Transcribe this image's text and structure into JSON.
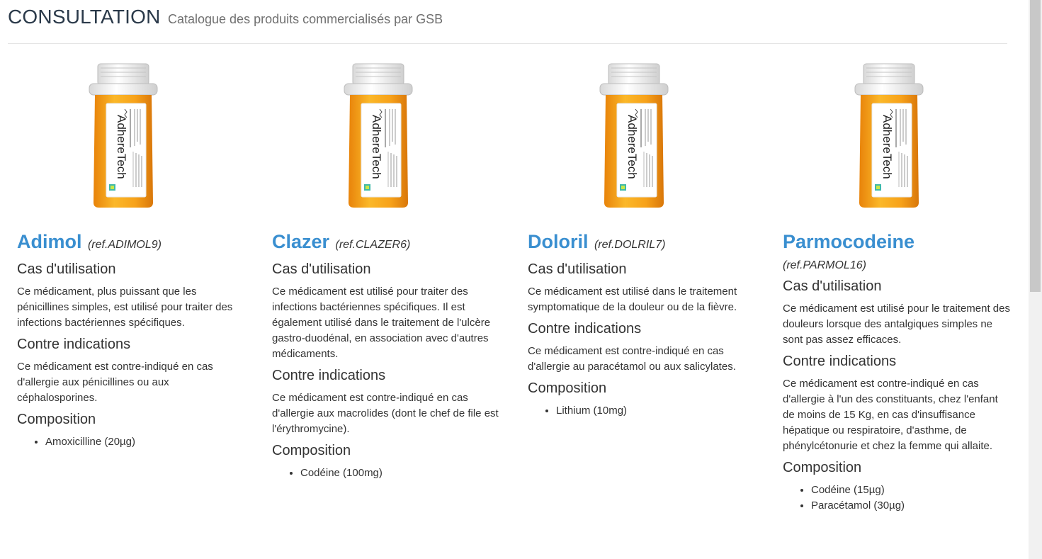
{
  "header": {
    "title": "CONSULTATION",
    "subtitle": "Catalogue des produits commercialisés par GSB"
  },
  "colors": {
    "accent": "#3a8fd0",
    "cap": "#eeeeee",
    "bottle": "#f5a316",
    "label": "#ffffff"
  },
  "bottle": {
    "brand": "AdhereTech"
  },
  "products": [
    {
      "name": "Adimol",
      "ref": "(ref.ADIMOL9)",
      "usage_heading": "Cas d'utilisation",
      "usage_text": "Ce médicament, plus puissant que les pénicillines simples, est utilisé pour traiter des infections bactériennes spécifiques.",
      "contra_heading": "Contre indications",
      "contra_text": "Ce médicament est contre-indiqué en cas d'allergie aux pénicillines ou aux céphalosporines.",
      "composition_heading": "Composition",
      "composition": [
        "Amoxicilline (20µg)"
      ]
    },
    {
      "name": "Clazer",
      "ref": "(ref.CLAZER6)",
      "usage_heading": "Cas d'utilisation",
      "usage_text": "Ce médicament est utilisé pour traiter des infections bactériennes spécifiques. Il est également utilisé dans le traitement de l'ulcère gastro-duodénal, en association avec d'autres médicaments.",
      "contra_heading": "Contre indications",
      "contra_text": "Ce médicament est contre-indiqué en cas d'allergie aux macrolides (dont le chef de file est l'érythromycine).",
      "composition_heading": "Composition",
      "composition": [
        "Codéine (100mg)"
      ]
    },
    {
      "name": "Doloril",
      "ref": "(ref.DOLRIL7)",
      "usage_heading": "Cas d'utilisation",
      "usage_text": "Ce médicament est utilisé dans le traitement symptomatique de la douleur ou de la fièvre.",
      "contra_heading": "Contre indications",
      "contra_text": "Ce médicament est contre-indiqué en cas d'allergie au paracétamol ou aux salicylates.",
      "composition_heading": "Composition",
      "composition": [
        "Lithium (10mg)"
      ]
    },
    {
      "name": "Parmocodeine",
      "ref": "(ref.PARMOL16)",
      "usage_heading": "Cas d'utilisation",
      "usage_text": "Ce médicament est utilisé pour le traitement des douleurs lorsque des antalgiques simples ne sont pas assez efficaces.",
      "contra_heading": "Contre indications",
      "contra_text": "Ce médicament est contre-indiqué en cas d'allergie à  l'un des constituants, chez l'enfant de moins de 15 Kg, en cas d'insuffisance hépatique ou respiratoire, d'asthme, de phénylcétonurie et chez la femme qui allaite.",
      "composition_heading": "Composition",
      "composition": [
        "Codéine (15µg)",
        "Paracétamol (30µg)"
      ]
    }
  ]
}
